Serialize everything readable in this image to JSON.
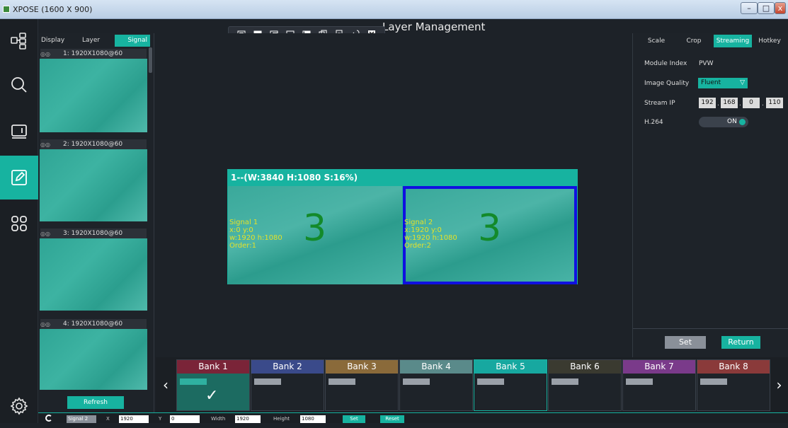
{
  "window": {
    "title": "XPOSE (1600 X 900)",
    "min_label": "–",
    "max_label": "□",
    "close_label": "x"
  },
  "header": {
    "title": "Layer Management"
  },
  "nav": [
    "layers-icon",
    "search-icon",
    "display-icon",
    "edit-icon",
    "apps-icon",
    "settings-icon"
  ],
  "signal_panel": {
    "tabs": [
      "Display Area",
      "Layer",
      "Signal"
    ],
    "active_tab": "Signal",
    "signals": [
      {
        "label": "1: 1920X1080@60"
      },
      {
        "label": "2: 1920X1080@60"
      },
      {
        "label": "3: 1920X1080@60"
      },
      {
        "label": "4: 1920X1080@60"
      }
    ],
    "refresh_label": "Refresh"
  },
  "screen": {
    "title": "1--(W:3840 H:1080 S:16%)",
    "layers": [
      {
        "line1": "Signal  1",
        "line2": "x:0  y:0",
        "line3": "w:1920  h:1080",
        "line4": "Order:1",
        "number": "3"
      },
      {
        "line1": "Signal  2",
        "line2": "x:1920  y:0",
        "line3": "w:1920  h:1080",
        "line4": "Order:2",
        "number": "3"
      }
    ]
  },
  "right_panel": {
    "tabs": [
      "Scale",
      "Crop",
      "Streaming",
      "Hotkey"
    ],
    "active_tab": "Streaming",
    "module_index_label": "Module Index",
    "module_index_value": "PVW",
    "image_quality_label": "Image Quality",
    "image_quality_value": "Fluent",
    "stream_ip_label": "Stream IP",
    "stream_ip": [
      "192",
      "168",
      "0",
      "110"
    ],
    "h264_label": "H.264",
    "h264_value": "ON",
    "set_label": "Set",
    "return_label": "Return"
  },
  "banks": [
    {
      "label": "Bank 1",
      "color": "#7a2438"
    },
    {
      "label": "Bank 2",
      "color": "#3a4a8a"
    },
    {
      "label": "Bank 3",
      "color": "#8a6a3a"
    },
    {
      "label": "Bank 4",
      "color": "#5a8a8a"
    },
    {
      "label": "Bank 5",
      "color": "#17a8a0"
    },
    {
      "label": "Bank 6",
      "color": "#3a3a30"
    },
    {
      "label": "Bank 7",
      "color": "#7a3a8a"
    },
    {
      "label": "Bank 8",
      "color": "#8a3a3a"
    }
  ],
  "status": {
    "signal": "Signal 2",
    "x_label": "X",
    "x_value": "1920",
    "y_label": "Y",
    "y_value": "0",
    "width_label": "Width",
    "width_value": "1920",
    "height_label": "Height",
    "height_value": "1080",
    "set_label": "Set",
    "reset_label": "Reset"
  }
}
